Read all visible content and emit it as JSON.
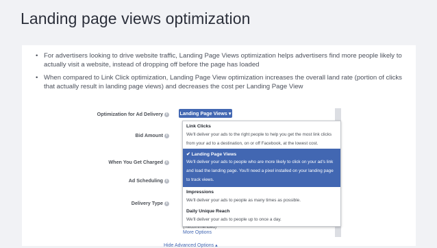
{
  "slide": {
    "title": "Landing page views optimization",
    "bullets": [
      "For advertisers looking to drive website traffic, Landing Page Views optimization helps advertisers find more people likely to actually visit a website, instead of dropping off before the page has loaded",
      "When compared to Link Click optimization, Landing Page View optimization increases the overall land rate (portion of clicks that actually result in landing page views) and decreases the cost per Landing Page View"
    ]
  },
  "ad_settings": {
    "rows": {
      "optimization": "Optimization for Ad Delivery",
      "bid": "Bid Amount",
      "charged": "When You Get Charged",
      "scheduling": "Ad Scheduling",
      "delivery": "Delivery Type"
    },
    "info_icon": "i",
    "dropdown": {
      "selected_label": "Landing Page Views ▾",
      "options": [
        {
          "title": "Link Clicks",
          "desc1": "We'll deliver your ads to the right people to help you get the most link clicks",
          "desc2": "from your ad to a destination, on or off Facebook, at the lowest cost.",
          "desc3": ""
        },
        {
          "title": "✔ Landing Page Views",
          "desc1": "We'll deliver your ads to people who are more likely to click on your ad's link",
          "desc2": "and load the landing page. You'll need a pixel installed on your landing page",
          "desc3": "to track views."
        },
        {
          "title": "Impressions",
          "desc1": "We'll deliver your ads to people as many times as possible.",
          "desc2": "",
          "desc3": ""
        },
        {
          "title": "Daily Unique Reach",
          "desc1": "We'll deliver your ads to people up to once a day.",
          "desc2": "",
          "desc3": ""
        }
      ]
    },
    "recommended": "(Recommended)",
    "more_options": "More Options",
    "hide_advanced": "Hide Advanced Options ▴"
  },
  "colors": {
    "accent": "#4267b2",
    "background": "#f1f2f5",
    "panel": "#ffffff"
  }
}
